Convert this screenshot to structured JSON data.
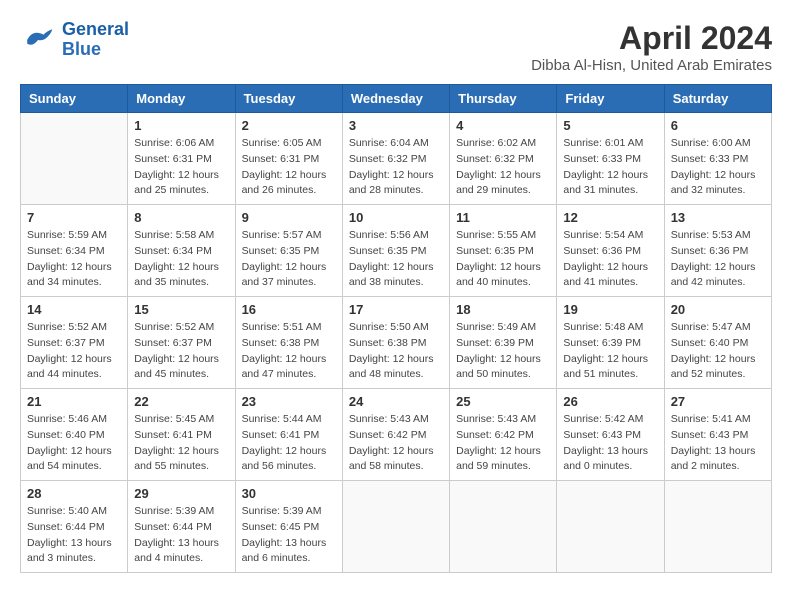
{
  "header": {
    "logo_line1": "General",
    "logo_line2": "Blue",
    "title": "April 2024",
    "subtitle": "Dibba Al-Hisn, United Arab Emirates"
  },
  "weekdays": [
    "Sunday",
    "Monday",
    "Tuesday",
    "Wednesday",
    "Thursday",
    "Friday",
    "Saturday"
  ],
  "weeks": [
    [
      {
        "day": "",
        "info": ""
      },
      {
        "day": "1",
        "info": "Sunrise: 6:06 AM\nSunset: 6:31 PM\nDaylight: 12 hours\nand 25 minutes."
      },
      {
        "day": "2",
        "info": "Sunrise: 6:05 AM\nSunset: 6:31 PM\nDaylight: 12 hours\nand 26 minutes."
      },
      {
        "day": "3",
        "info": "Sunrise: 6:04 AM\nSunset: 6:32 PM\nDaylight: 12 hours\nand 28 minutes."
      },
      {
        "day": "4",
        "info": "Sunrise: 6:02 AM\nSunset: 6:32 PM\nDaylight: 12 hours\nand 29 minutes."
      },
      {
        "day": "5",
        "info": "Sunrise: 6:01 AM\nSunset: 6:33 PM\nDaylight: 12 hours\nand 31 minutes."
      },
      {
        "day": "6",
        "info": "Sunrise: 6:00 AM\nSunset: 6:33 PM\nDaylight: 12 hours\nand 32 minutes."
      }
    ],
    [
      {
        "day": "7",
        "info": "Sunrise: 5:59 AM\nSunset: 6:34 PM\nDaylight: 12 hours\nand 34 minutes."
      },
      {
        "day": "8",
        "info": "Sunrise: 5:58 AM\nSunset: 6:34 PM\nDaylight: 12 hours\nand 35 minutes."
      },
      {
        "day": "9",
        "info": "Sunrise: 5:57 AM\nSunset: 6:35 PM\nDaylight: 12 hours\nand 37 minutes."
      },
      {
        "day": "10",
        "info": "Sunrise: 5:56 AM\nSunset: 6:35 PM\nDaylight: 12 hours\nand 38 minutes."
      },
      {
        "day": "11",
        "info": "Sunrise: 5:55 AM\nSunset: 6:35 PM\nDaylight: 12 hours\nand 40 minutes."
      },
      {
        "day": "12",
        "info": "Sunrise: 5:54 AM\nSunset: 6:36 PM\nDaylight: 12 hours\nand 41 minutes."
      },
      {
        "day": "13",
        "info": "Sunrise: 5:53 AM\nSunset: 6:36 PM\nDaylight: 12 hours\nand 42 minutes."
      }
    ],
    [
      {
        "day": "14",
        "info": "Sunrise: 5:52 AM\nSunset: 6:37 PM\nDaylight: 12 hours\nand 44 minutes."
      },
      {
        "day": "15",
        "info": "Sunrise: 5:52 AM\nSunset: 6:37 PM\nDaylight: 12 hours\nand 45 minutes."
      },
      {
        "day": "16",
        "info": "Sunrise: 5:51 AM\nSunset: 6:38 PM\nDaylight: 12 hours\nand 47 minutes."
      },
      {
        "day": "17",
        "info": "Sunrise: 5:50 AM\nSunset: 6:38 PM\nDaylight: 12 hours\nand 48 minutes."
      },
      {
        "day": "18",
        "info": "Sunrise: 5:49 AM\nSunset: 6:39 PM\nDaylight: 12 hours\nand 50 minutes."
      },
      {
        "day": "19",
        "info": "Sunrise: 5:48 AM\nSunset: 6:39 PM\nDaylight: 12 hours\nand 51 minutes."
      },
      {
        "day": "20",
        "info": "Sunrise: 5:47 AM\nSunset: 6:40 PM\nDaylight: 12 hours\nand 52 minutes."
      }
    ],
    [
      {
        "day": "21",
        "info": "Sunrise: 5:46 AM\nSunset: 6:40 PM\nDaylight: 12 hours\nand 54 minutes."
      },
      {
        "day": "22",
        "info": "Sunrise: 5:45 AM\nSunset: 6:41 PM\nDaylight: 12 hours\nand 55 minutes."
      },
      {
        "day": "23",
        "info": "Sunrise: 5:44 AM\nSunset: 6:41 PM\nDaylight: 12 hours\nand 56 minutes."
      },
      {
        "day": "24",
        "info": "Sunrise: 5:43 AM\nSunset: 6:42 PM\nDaylight: 12 hours\nand 58 minutes."
      },
      {
        "day": "25",
        "info": "Sunrise: 5:43 AM\nSunset: 6:42 PM\nDaylight: 12 hours\nand 59 minutes."
      },
      {
        "day": "26",
        "info": "Sunrise: 5:42 AM\nSunset: 6:43 PM\nDaylight: 13 hours\nand 0 minutes."
      },
      {
        "day": "27",
        "info": "Sunrise: 5:41 AM\nSunset: 6:43 PM\nDaylight: 13 hours\nand 2 minutes."
      }
    ],
    [
      {
        "day": "28",
        "info": "Sunrise: 5:40 AM\nSunset: 6:44 PM\nDaylight: 13 hours\nand 3 minutes."
      },
      {
        "day": "29",
        "info": "Sunrise: 5:39 AM\nSunset: 6:44 PM\nDaylight: 13 hours\nand 4 minutes."
      },
      {
        "day": "30",
        "info": "Sunrise: 5:39 AM\nSunset: 6:45 PM\nDaylight: 13 hours\nand 6 minutes."
      },
      {
        "day": "",
        "info": ""
      },
      {
        "day": "",
        "info": ""
      },
      {
        "day": "",
        "info": ""
      },
      {
        "day": "",
        "info": ""
      }
    ]
  ]
}
